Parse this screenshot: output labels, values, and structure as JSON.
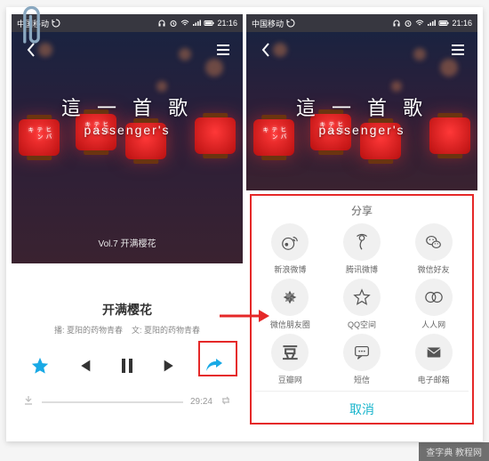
{
  "status": {
    "carrier": "中国移动",
    "time": "21:16"
  },
  "cover": {
    "title_cn": "這 一 首 歌",
    "title_en": "passenger's",
    "lantern_text": "ヒバテンキ",
    "volume_text": "Vol.7 开满樱花"
  },
  "track": {
    "title": "开满樱花",
    "broadcast_label": "播:",
    "broadcast_value": "夏阳的药物青春",
    "text_label": "文:",
    "text_value": "夏阳的药物青春",
    "duration": "29:24"
  },
  "share": {
    "title": "分享",
    "items": [
      {
        "key": "weibo",
        "label": "新浪微博"
      },
      {
        "key": "tencent-weibo",
        "label": "腾讯微博"
      },
      {
        "key": "wechat",
        "label": "微信好友"
      },
      {
        "key": "moments",
        "label": "微信朋友圈"
      },
      {
        "key": "qzone",
        "label": "QQ空间"
      },
      {
        "key": "renren",
        "label": "人人网"
      },
      {
        "key": "douban",
        "label": "豆瓣网"
      },
      {
        "key": "sms",
        "label": "短信"
      },
      {
        "key": "email",
        "label": "电子邮箱"
      }
    ],
    "cancel": "取消"
  },
  "watermark": "查字典  教程网"
}
